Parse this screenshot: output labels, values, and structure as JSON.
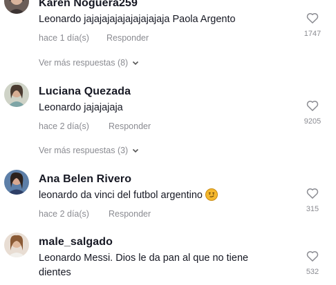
{
  "comments": [
    {
      "username": "Karen Noguera259",
      "text": "Leonardo jajajajajajajajajajaja Paola Argento",
      "time": "hace 1 día(s)",
      "reply_label": "Responder",
      "likes": "1747",
      "more_replies": "Ver más respuestas (8)",
      "avatar_icon": "avatar-karen"
    },
    {
      "username": "Luciana Quezada",
      "text": "Leonardo jajajajaja",
      "time": "hace 2 día(s)",
      "reply_label": "Responder",
      "likes": "9205",
      "more_replies": "Ver más respuestas (3)",
      "avatar_icon": "avatar-luciana"
    },
    {
      "username": "Ana Belen Rivero",
      "text": "leonardo da vinci del futbol argentino",
      "emoji": "smirk-emoji",
      "time": "hace 2 día(s)",
      "reply_label": "Responder",
      "likes": "315",
      "avatar_icon": "avatar-ana"
    },
    {
      "username": "male_salgado",
      "text_line1": "Leonardo Messi. Dios le da pan al que no tiene",
      "text_line2": "dientes",
      "likes": "532",
      "avatar_icon": "avatar-male"
    }
  ],
  "icons": {
    "like": "heart-outline-icon",
    "expand": "chevron-down-icon"
  },
  "colors": {
    "text": "#161823",
    "muted": "#8a8b91",
    "icon": "#8a8b91"
  }
}
